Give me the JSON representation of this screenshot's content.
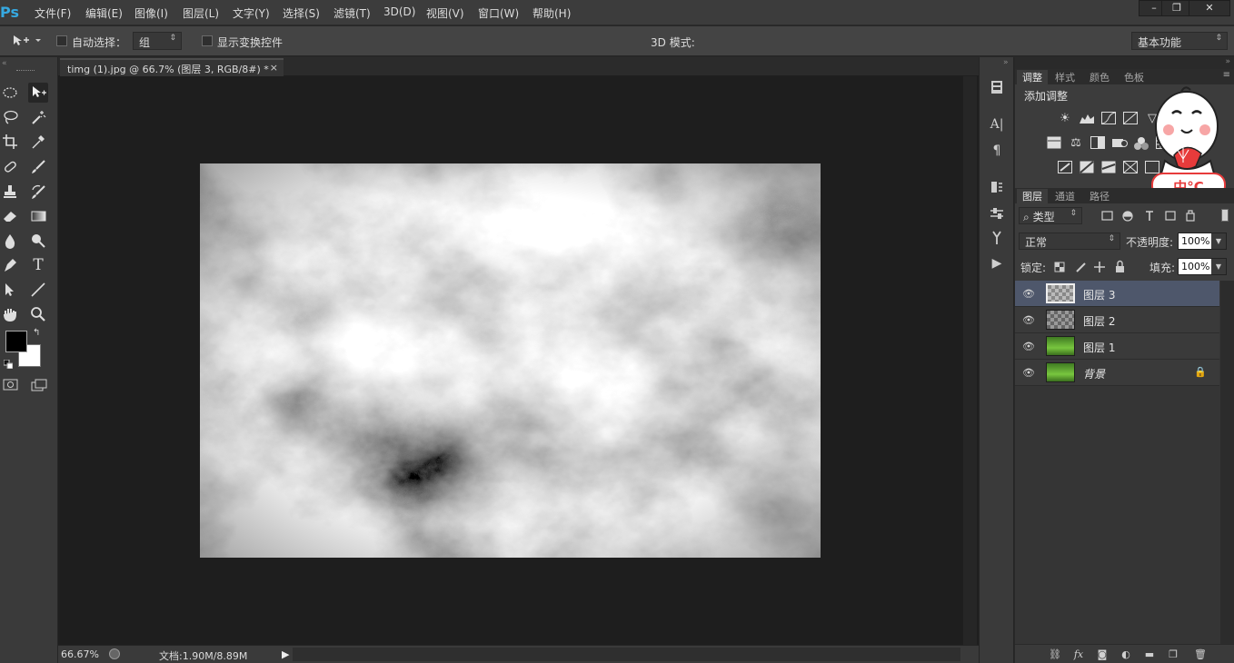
{
  "app": {
    "logo": "Ps"
  },
  "menu": [
    "文件(F)",
    "编辑(E)",
    "图像(I)",
    "图层(L)",
    "文字(Y)",
    "选择(S)",
    "滤镜(T)",
    "3D(D)",
    "视图(V)",
    "窗口(W)",
    "帮助(H)"
  ],
  "window_controls": {
    "minimize": "–",
    "restore": "❐",
    "close": "✕"
  },
  "options": {
    "auto_select_label": "自动选择：",
    "auto_select_value": "组",
    "show_transform_label": "显示变换控件",
    "mode_3d_label": "3D 模式:",
    "workspace": "基本功能"
  },
  "document": {
    "tab_title": "timg (1).jpg @ 66.7% (图层 3, RGB/8#) *",
    "tab_close": "×"
  },
  "status": {
    "zoom": "66.67%",
    "doc_info": "文档:1.90M/8.89M"
  },
  "adjustments_panel": {
    "tabs": [
      "调整",
      "样式",
      "颜色",
      "色板"
    ],
    "active_tab": "调整",
    "heading": "添加调整"
  },
  "layers_panel": {
    "tabs": [
      "图层",
      "通道",
      "路径"
    ],
    "filter_label": "类型",
    "blend_mode": "正常",
    "opacity_label": "不透明度:",
    "opacity_value": "100%",
    "lock_label": "锁定:",
    "fill_label": "填充:",
    "fill_value": "100%",
    "layers": [
      {
        "name": "图层 3",
        "selected": true,
        "thumb": "clouds",
        "locked": false
      },
      {
        "name": "图层 2",
        "selected": false,
        "thumb": "clouds-dark",
        "locked": false
      },
      {
        "name": "图层 1",
        "selected": false,
        "thumb": "grass",
        "locked": false
      },
      {
        "name": "背景",
        "selected": false,
        "thumb": "grass",
        "locked": true
      }
    ]
  },
  "watermark": {
    "text": "中°C"
  },
  "colors": {
    "selected_layer": "#4e576b",
    "ps_blue": "#36a9e1",
    "foreground": "#000000",
    "background": "#ffffff"
  }
}
